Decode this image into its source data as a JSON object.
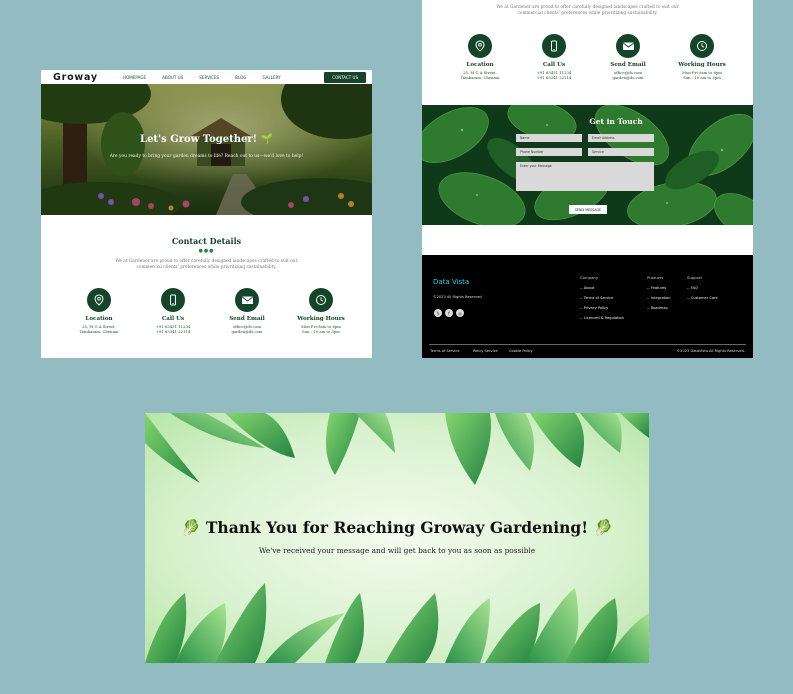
{
  "contact_page": {
    "nav": {
      "brand": "Groway",
      "links": [
        "HOMEPAGE",
        "ABOUT US",
        "SERVICES",
        "BLOG",
        "GALLERY"
      ],
      "cta": "CONTACT US"
    },
    "hero": {
      "title": "Let's Grow Together! 🌱",
      "subtitle": "Are you ready to bring your garden dreams to life? Reach out to us—we'd love to help!"
    },
    "section": {
      "title": "Contact Details",
      "dots": "●●●",
      "description": "We at Gardener are proud to offer carefully designed landscapes crafted to suit our commercial clients' preferences while prioritizing sustainability."
    },
    "features": [
      {
        "icon": "location-pin-icon",
        "title": "Location",
        "lines": [
          "25, M G A Street,",
          "Tambaram, Chennai"
        ]
      },
      {
        "icon": "phone-icon",
        "title": "Call Us",
        "lines": [
          "+91 65431 11234",
          "+91 65341 22114"
        ]
      },
      {
        "icon": "email-icon",
        "title": "Send Email",
        "lines": [
          "office@ds.com",
          "garden@ds.com"
        ]
      },
      {
        "icon": "clock-icon",
        "title": "Working Hours",
        "lines": [
          "Mon-Fri:9am to 6pm",
          "Sun : 10 am to 3pm"
        ]
      }
    ]
  },
  "form_page": {
    "section_description": "We at Gardener are proud to offer carefully designed landscapes crafted to suit our commercial clients' preferences while prioritizing sustainability.",
    "features": [
      {
        "icon": "location-pin-icon",
        "title": "Location",
        "lines": [
          "25, M G A Street,",
          "Tambaram, Chennai"
        ]
      },
      {
        "icon": "phone-icon",
        "title": "Call Us",
        "lines": [
          "+91 65431 11234",
          "+91 65341 22114"
        ]
      },
      {
        "icon": "email-icon",
        "title": "Send Email",
        "lines": [
          "office@ds.com",
          "garden@ds.com"
        ]
      },
      {
        "icon": "clock-icon",
        "title": "Working Hours",
        "lines": [
          "Mon-Fri:9am to 6pm",
          "Sun : 10 am to 3pm"
        ]
      }
    ],
    "form": {
      "title": "Get in Touch",
      "name_placeholder": "Name",
      "email_placeholder": "Email Address",
      "phone_placeholder": "Phone Number",
      "service_placeholder": "Service",
      "message_placeholder": "Enter your Message",
      "submit": "SEND MESSAGE"
    },
    "footer": {
      "brand": "Data Vista",
      "copyright": "©2023 All Rights Reserved",
      "socials": [
        "x-icon",
        "facebook-icon",
        "instagram-icon"
      ],
      "columns": [
        {
          "heading": "Company",
          "items": [
            "-- About",
            "-- Terms of Service",
            "-- Privacy Policy",
            "-- Licenced & Regulation"
          ]
        },
        {
          "heading": "Products",
          "items": [
            "-- Features",
            "-- Integration",
            "-- Roadmap"
          ]
        },
        {
          "heading": "Support",
          "items": [
            "-- FAQ",
            "-- Customer Care"
          ]
        }
      ],
      "bottom_links": [
        "Terms of Service",
        "Policy Service",
        "Cookie Policy"
      ],
      "bottom_copyright": "©2023 DataVista All Rights Reserved."
    }
  },
  "thanks_page": {
    "title": "🥬 Thank You for Reaching Groway Gardening! 🥬",
    "subtitle": "We've received your message and will get back to you as soon as possible"
  },
  "colors": {
    "background": "#93bcc2",
    "primary_green": "#14442a",
    "footer_black": "#000000",
    "footer_brand": "#2ad3e2"
  }
}
